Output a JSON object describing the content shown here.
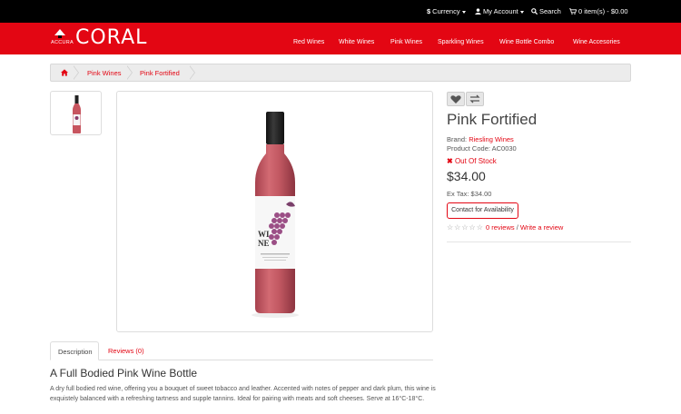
{
  "topbar": {
    "currency_icon": "$",
    "currency_label": "Currency",
    "account_label": "My Account",
    "search_label": "Search",
    "cart_label": "0 item(s) - $0.00"
  },
  "header": {
    "logo_sub": "ACCURA",
    "logo_main": "CORAL",
    "nav": [
      "Red Wines",
      "White Wines",
      "Pink Wines",
      "Sparkling Wines",
      "Wine Bottle Combo",
      "Wine Accesories"
    ]
  },
  "breadcrumb": {
    "items": [
      "Pink Wines",
      "Pink Fortified"
    ]
  },
  "product": {
    "title": "Pink Fortified",
    "brand_label": "Brand:",
    "brand_value": "Riesling Wines",
    "code_label": "Product Code:",
    "code_value": "AC0030",
    "stock": "Out Of Stock",
    "price": "$34.00",
    "ex_tax": "Ex Tax: $34.00",
    "contact_button": "Contact for Availability",
    "reviews_link": "0 reviews",
    "review_sep": "/",
    "write_review": "Write a review",
    "rating": 0,
    "bottle_label": "WI\nNE"
  },
  "tabs": [
    "Description",
    "Reviews (0)"
  ],
  "description": {
    "title": "A Full Bodied Pink Wine Bottle",
    "body": "A dry full bodied red wine, offering you a bouquet of sweet tobacco and leather. Accented with notes of pepper and dark plum, this wine is exquistely balanced with a refreshing tartness and supple tannins. Ideal for pairing with meats and soft cheeses. Serve at 16°C-18°C."
  },
  "colors": {
    "brand_red": "#e30613",
    "topbar": "#000000",
    "wine": "#c7555f"
  }
}
